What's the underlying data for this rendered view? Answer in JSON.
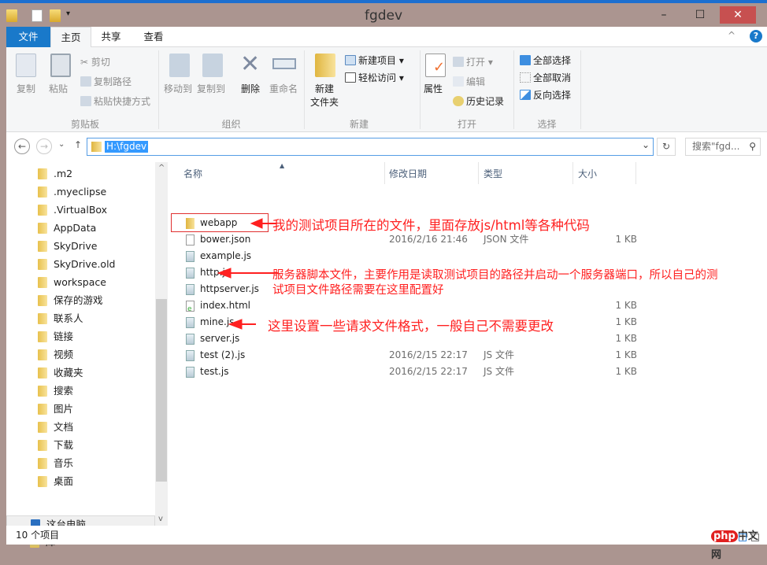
{
  "window": {
    "title": "fgdev",
    "minimize": "–",
    "maximize": "☐",
    "close": "✕"
  },
  "tabs": [
    "文件",
    "主页",
    "共享",
    "查看"
  ],
  "ribbon": {
    "clipboard": {
      "label": "剪贴板",
      "copy": "复制",
      "paste": "粘贴",
      "cut": "剪切",
      "copy_path": "复制路径",
      "paste_shortcut": "粘贴快捷方式"
    },
    "organize": {
      "label": "组织",
      "move_to": "移动到",
      "copy_to": "复制到",
      "delete": "删除",
      "rename": "重命名"
    },
    "new": {
      "label": "新建",
      "new_folder_line1": "新建",
      "new_folder_line2": "文件夹",
      "new_item": "新建项目 ▾",
      "easy_access": "轻松访问 ▾"
    },
    "open": {
      "label": "打开",
      "properties": "属性",
      "open": "打开 ▾",
      "edit": "编辑",
      "history": "历史记录"
    },
    "select": {
      "label": "选择",
      "select_all": "全部选择",
      "select_none": "全部取消",
      "invert": "反向选择"
    }
  },
  "address": {
    "path": "H:\\fgdev",
    "search_placeholder": "搜索\"fgd...",
    "back": "←",
    "forward": "→",
    "up": "↑",
    "refresh": "↻",
    "dropdown": "⌄",
    "recent": "⌄",
    "search_icon": "⚲"
  },
  "sidebar": {
    "items": [
      ".m2",
      ".myeclipse",
      ".VirtualBox",
      "AppData",
      "SkyDrive",
      "SkyDrive.old",
      "workspace",
      "保存的游戏",
      "联系人",
      "链接",
      "视频",
      "收藏夹",
      "搜索",
      "图片",
      "文档",
      "下载",
      "音乐",
      "桌面",
      "这台电脑",
      "库"
    ]
  },
  "columns": {
    "name": "名称",
    "date": "修改日期",
    "type": "类型",
    "size": "大小"
  },
  "files": [
    {
      "name": "webapp",
      "date": "",
      "type": "",
      "size": "",
      "icon": "folder"
    },
    {
      "name": "bower.json",
      "date": "2016/2/16 21:46",
      "type": "JSON 文件",
      "size": "1 KB",
      "icon": "file"
    },
    {
      "name": "example.js",
      "date": "",
      "type": "",
      "size": "",
      "icon": "js"
    },
    {
      "name": "http.js",
      "date": "",
      "type": "",
      "size": "",
      "icon": "js"
    },
    {
      "name": "httpserver.js",
      "date": "",
      "type": "",
      "size": "",
      "icon": "js"
    },
    {
      "name": "index.html",
      "date": "",
      "type": "",
      "size": "1 KB",
      "icon": "html"
    },
    {
      "name": "mine.js",
      "date": "",
      "type": "",
      "size": "1 KB",
      "icon": "js"
    },
    {
      "name": "server.js",
      "date": "",
      "type": "",
      "size": "1 KB",
      "icon": "js"
    },
    {
      "name": "test (2).js",
      "date": "2016/2/15 22:17",
      "type": "JS 文件",
      "size": "1 KB",
      "icon": "js"
    },
    {
      "name": "test.js",
      "date": "2016/2/15 22:17",
      "type": "JS 文件",
      "size": "1 KB",
      "icon": "js"
    }
  ],
  "annotations": {
    "webapp": "我的测试项目所在的文件，里面存放js/html等各种代码",
    "http_line1": "服务器脚本文件，主要作用是读取测试项目的路径并启动一个服务器端口，所以自己的测",
    "http_line2": "试项目文件路径需要在这里配置好",
    "mine": "这里设置一些请求文件格式，一般自己不需要更改",
    "color": "#ff2020"
  },
  "status": {
    "count": "10 个项目"
  },
  "watermark": "php中文网"
}
